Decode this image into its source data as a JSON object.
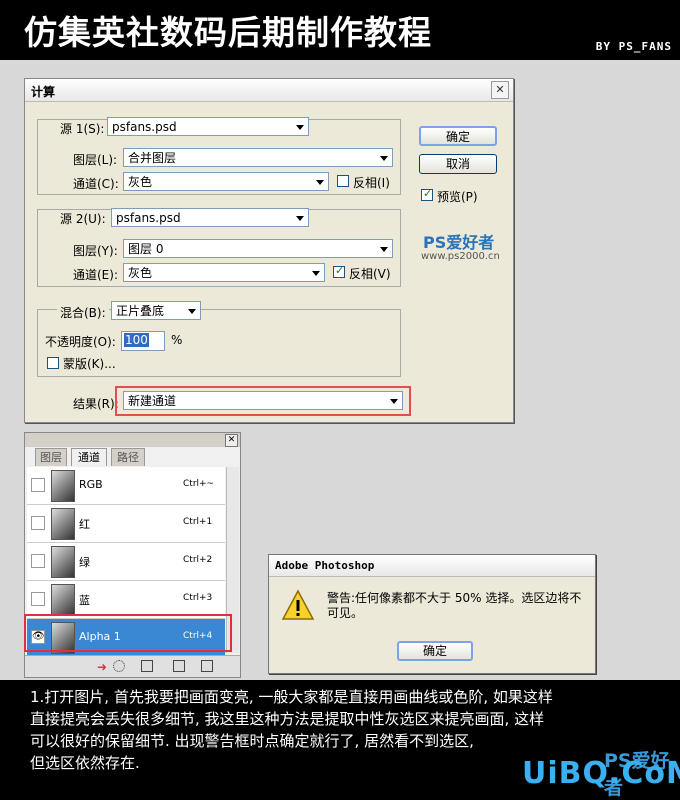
{
  "header": {
    "title": "仿集英社数码后期制作教程",
    "byline": "BY PS_FANS"
  },
  "calc_dialog": {
    "title": "计算",
    "source1": {
      "label": "源 1(S):",
      "file": "psfans.psd",
      "layer_label": "图层(L):",
      "layer_value": "合并图层",
      "channel_label": "通道(C):",
      "channel_value": "灰色",
      "invert_label": "反相(I)",
      "invert_checked": false
    },
    "source2": {
      "label": "源 2(U):",
      "file": "psfans.psd",
      "layer_label": "图层(Y):",
      "layer_value": "图层 0",
      "channel_label": "通道(E):",
      "channel_value": "灰色",
      "invert_label": "反相(V)",
      "invert_checked": true
    },
    "blending": {
      "label": "混合(B):",
      "value": "正片叠底",
      "opacity_label": "不透明度(O):",
      "opacity_value": "100",
      "opacity_unit": "%",
      "mask_label": "蒙版(K)..."
    },
    "result": {
      "label": "结果(R):",
      "value": "新建通道"
    },
    "buttons": {
      "ok": "确定",
      "cancel": "取消"
    },
    "preview_label": "预览(P)",
    "preview_checked": true,
    "watermark": "PS爱好者",
    "watermark_url": "www.ps2000.cn"
  },
  "channels_panel": {
    "tabs": [
      "图层",
      "通道",
      "路径"
    ],
    "rows": [
      {
        "name": "RGB",
        "shortcut": "Ctrl+~",
        "visible": false,
        "selected": false
      },
      {
        "name": "红",
        "shortcut": "Ctrl+1",
        "visible": false,
        "selected": false
      },
      {
        "name": "绿",
        "shortcut": "Ctrl+2",
        "visible": false,
        "selected": false
      },
      {
        "name": "蓝",
        "shortcut": "Ctrl+3",
        "visible": false,
        "selected": false
      },
      {
        "name": "Alpha 1",
        "shortcut": "Ctrl+4",
        "visible": true,
        "selected": true
      }
    ],
    "footer_icons": [
      "load-selection-icon",
      "save-selection-icon",
      "new-channel-icon",
      "delete-channel-icon"
    ]
  },
  "warning_dialog": {
    "title": "Adobe Photoshop",
    "message": "警告:任何像素都不大于 50% 选择。选区边将不可见。",
    "ok": "确定",
    "icon": "warning-icon"
  },
  "caption": {
    "lines": [
      "1.打开图片, 首先我要把画面变亮, 一般大家都是直接用画曲线或色阶, 如果这样",
      "直接提亮会丢失很多细节, 我这里这种方法是提取中性灰选区来提亮画面, 这样",
      "可以很好的保留细节. 出现警告框时点确定就行了, 居然看不到选区,",
      "但选区依然存在."
    ]
  },
  "watermarks": {
    "ps_lover": "PS爱好者",
    "uibq": "UiBQ.CoM"
  },
  "colors": {
    "background": "#000000",
    "canvas": "#d8d8d8",
    "dialog": "#ece9d8",
    "selection": "#3a87d4",
    "highlight_border": "#e03040",
    "watermark": "#2a73b8"
  }
}
